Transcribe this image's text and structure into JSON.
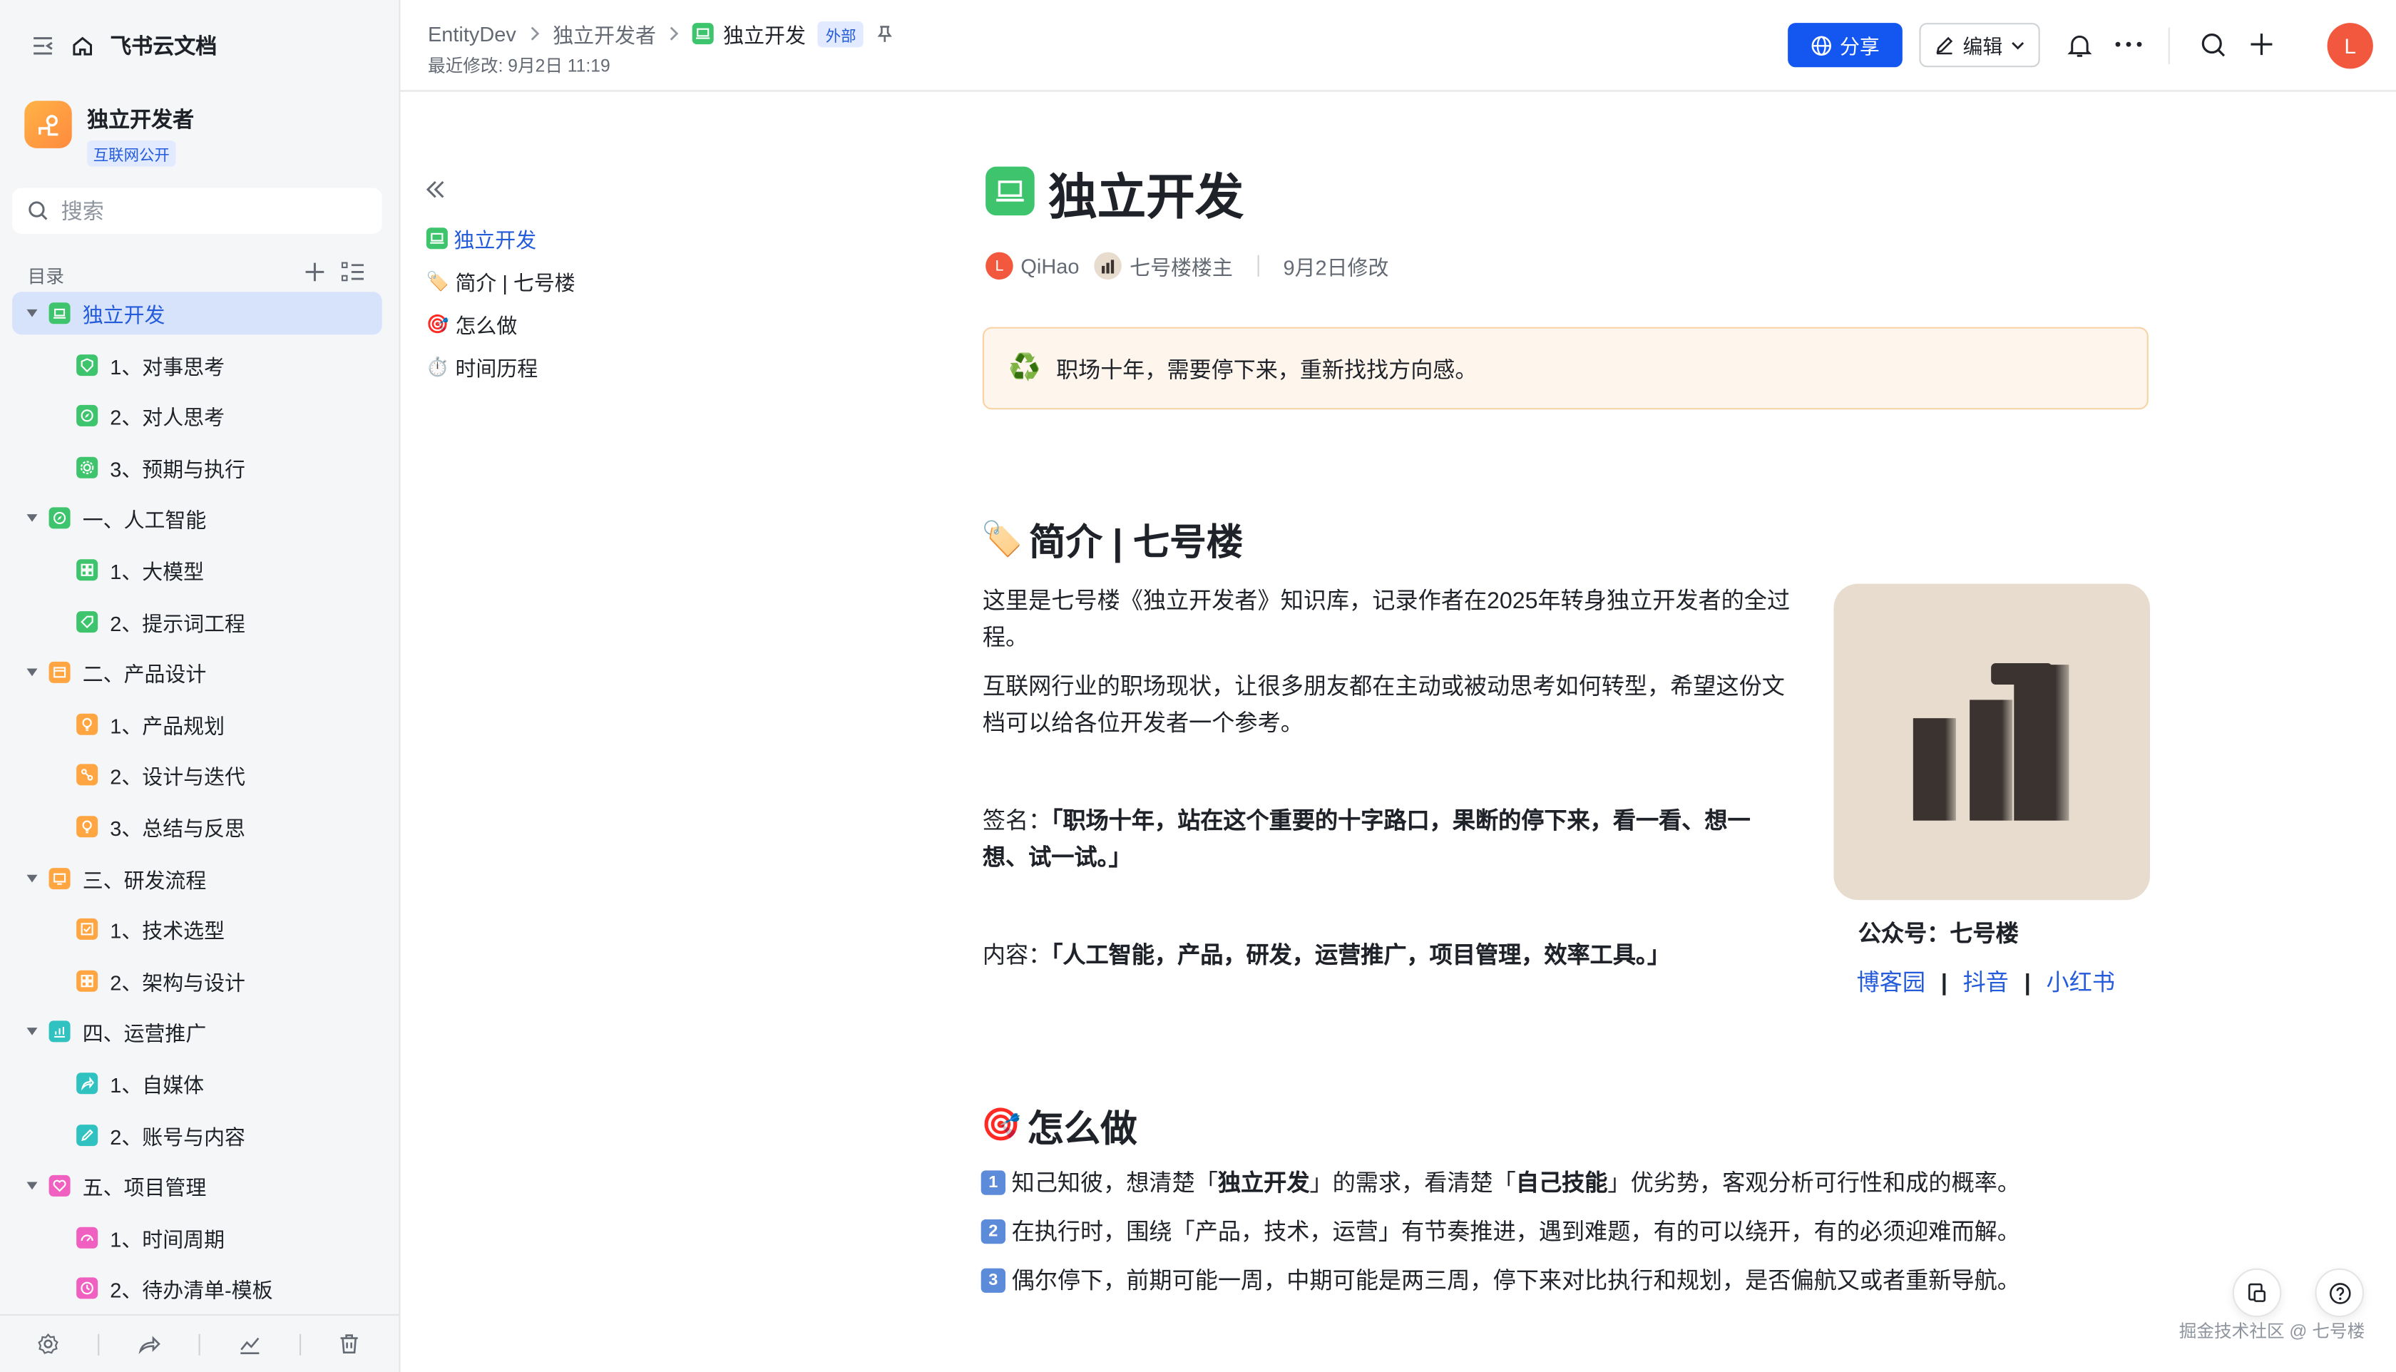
{
  "sidebar": {
    "app_title": "飞书云文档",
    "space": {
      "name": "独立开发者",
      "tag": "互联网公开"
    },
    "search_placeholder": "搜索",
    "toc_label": "目录",
    "tree": [
      {
        "label": "独立开发",
        "icon": "laptop-icon",
        "color": "#3ec46d",
        "level": 0,
        "expanded": true,
        "active": true
      },
      {
        "label": "1、对事思考",
        "icon": "shield-icon",
        "color": "#3ec46d",
        "level": 1
      },
      {
        "label": "2、对人思考",
        "icon": "compass-icon",
        "color": "#3ec46d",
        "level": 1
      },
      {
        "label": "3、预期与执行",
        "icon": "gear-icon",
        "color": "#3ec46d",
        "level": 1
      },
      {
        "label": "一、人工智能",
        "icon": "compass-icon",
        "color": "#3ec46d",
        "level": 0,
        "expanded": true
      },
      {
        "label": "1、大模型",
        "icon": "grid-icon",
        "color": "#3ec46d",
        "level": 1
      },
      {
        "label": "2、提示词工程",
        "icon": "tag-icon",
        "color": "#3ec46d",
        "level": 1
      },
      {
        "label": "二、产品设计",
        "icon": "box-icon",
        "color": "#ffa642",
        "level": 0,
        "expanded": true
      },
      {
        "label": "1、产品规划",
        "icon": "bulb-icon",
        "color": "#ffa642",
        "level": 1
      },
      {
        "label": "2、设计与迭代",
        "icon": "flow-icon",
        "color": "#ffa642",
        "level": 1
      },
      {
        "label": "3、总结与反思",
        "icon": "bulb-icon",
        "color": "#ffa642",
        "level": 1
      },
      {
        "label": "三、研发流程",
        "icon": "screen-icon",
        "color": "#ffa642",
        "level": 0,
        "expanded": true
      },
      {
        "label": "1、技术选型",
        "icon": "check-icon",
        "color": "#ffa642",
        "level": 1
      },
      {
        "label": "2、架构与设计",
        "icon": "grid-icon",
        "color": "#ffa642",
        "level": 1
      },
      {
        "label": "四、运营推广",
        "icon": "chart-icon",
        "color": "#2fc2c0",
        "level": 0,
        "expanded": true
      },
      {
        "label": "1、自媒体",
        "icon": "share-icon",
        "color": "#2fc2c0",
        "level": 1
      },
      {
        "label": "2、账号与内容",
        "icon": "edit-icon",
        "color": "#2fc2c0",
        "level": 1
      },
      {
        "label": "五、项目管理",
        "icon": "heart-icon",
        "color": "#f060c0",
        "level": 0,
        "expanded": true
      },
      {
        "label": "1、时间周期",
        "icon": "gauge-icon",
        "color": "#f060c0",
        "level": 1
      },
      {
        "label": "2、待办清单-模板",
        "icon": "clock-icon",
        "color": "#f060c0",
        "level": 1
      }
    ]
  },
  "header": {
    "breadcrumbs": [
      "EntityDev",
      "独立开发者",
      "独立开发"
    ],
    "external_badge": "外部",
    "last_modified": "最近修改: 9月2日 11:19",
    "share_label": "分享",
    "edit_label": "编辑",
    "avatar_letter": "L"
  },
  "outline": [
    {
      "label": "独立开发",
      "emoji": "💻",
      "active": true
    },
    {
      "label": "简介 | 七号楼",
      "emoji": "🏷️"
    },
    {
      "label": "怎么做",
      "emoji": "🎯"
    },
    {
      "label": "时间历程",
      "emoji": "⏱️"
    }
  ],
  "doc": {
    "title": "独立开发",
    "author": "QiHao",
    "author_initial": "L",
    "owner": "七号楼楼主",
    "modified": "9月2日修改",
    "callout_emoji": "♻️",
    "callout": "职场十年，需要停下来，重新找找方向感。",
    "section1": {
      "emoji": "🏷️",
      "heading": "简介 | 七号楼",
      "p1": "这里是七号楼《独立开发者》知识库，记录作者在2025年转身独立开发者的全过程。",
      "p2": "互联网行业的职场现状，让很多朋友都在主动或被动思考如何转型，希望这份文档可以给各位开发者一个参考。",
      "sign_label": "签名：",
      "sign_text": "「职场十年，站在这个重要的十字路口，果断的停下来，看一看、想一想、试一试。」",
      "content_label": "内容：",
      "content_text": "「人工智能，产品，研发，运营推广，项目管理，效率工具。」",
      "gzh": "公众号：七号楼",
      "links": [
        "博客园",
        "抖音",
        "小红书"
      ],
      "link_sep": "|"
    },
    "section2": {
      "emoji": "🎯",
      "heading": "怎么做",
      "steps": [
        {
          "key": "1",
          "pre": "知己知彼，想清楚「",
          "b1": "独立开发",
          "mid": "」的需求，看清楚「",
          "b2": "自己技能",
          "post": "」优劣势，客观分析可行性和成的概率。"
        },
        {
          "key": "2",
          "text": "在执行时，围绕「产品，技术，运营」有节奏推进，遇到难题，有的可以绕开，有的必须迎难而解。"
        },
        {
          "key": "3",
          "text": "偶尔停下，前期可能一周，中期可能是两三周，停下来对比执行和规划，是否偏航又或者重新导航。"
        }
      ]
    }
  },
  "watermark": "掘金技术社区 @ 七号楼"
}
